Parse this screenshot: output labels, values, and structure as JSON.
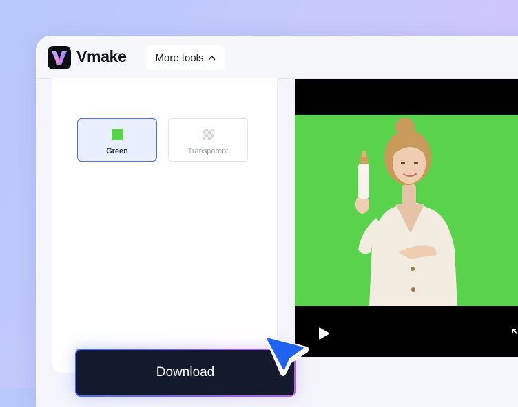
{
  "app": {
    "name": "Vmake"
  },
  "toolbar": {
    "more_tools_label": "More tools"
  },
  "background_options": [
    {
      "label": "Green",
      "color": "#58d34b",
      "selected": true
    },
    {
      "label": "Transparent",
      "selected": false
    }
  ],
  "download": {
    "label": "Download"
  },
  "colors": {
    "accent": "#4a6fe3",
    "green_screen": "#58d34b",
    "button_dark": "#131a2b",
    "cursor": "#1f63f0"
  },
  "icons": [
    "vmake-logo-icon",
    "chevron-up-icon",
    "play-icon",
    "fullscreen-icon",
    "pointer-cursor-icon"
  ]
}
